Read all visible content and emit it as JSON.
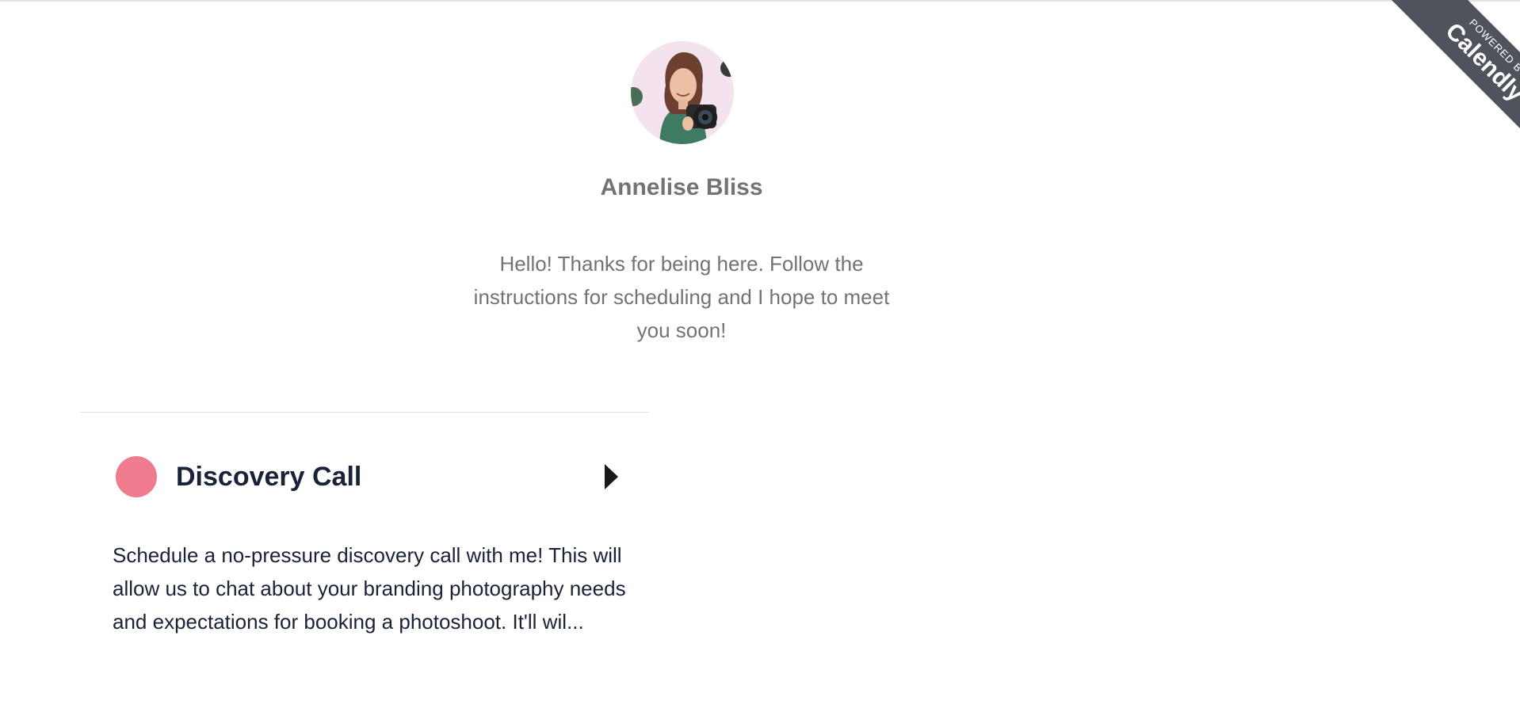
{
  "profile": {
    "name": "Annelise Bliss",
    "welcome_message": "Hello! Thanks for being here. Follow the instructions for scheduling and I hope to meet you soon!"
  },
  "event": {
    "title": "Discovery Call",
    "description": "Schedule a no-pressure discovery call with me! This will allow us to chat about your branding photography needs and expectations for booking a photoshoot. It'll wil...",
    "color": "#f07b8e"
  },
  "badge": {
    "powered_by": "POWERED BY",
    "brand": "Calendly",
    "color": "#4f545c"
  },
  "icons": {
    "event_arrow": "caret-right-icon",
    "event_dot": "color-dot-icon"
  }
}
